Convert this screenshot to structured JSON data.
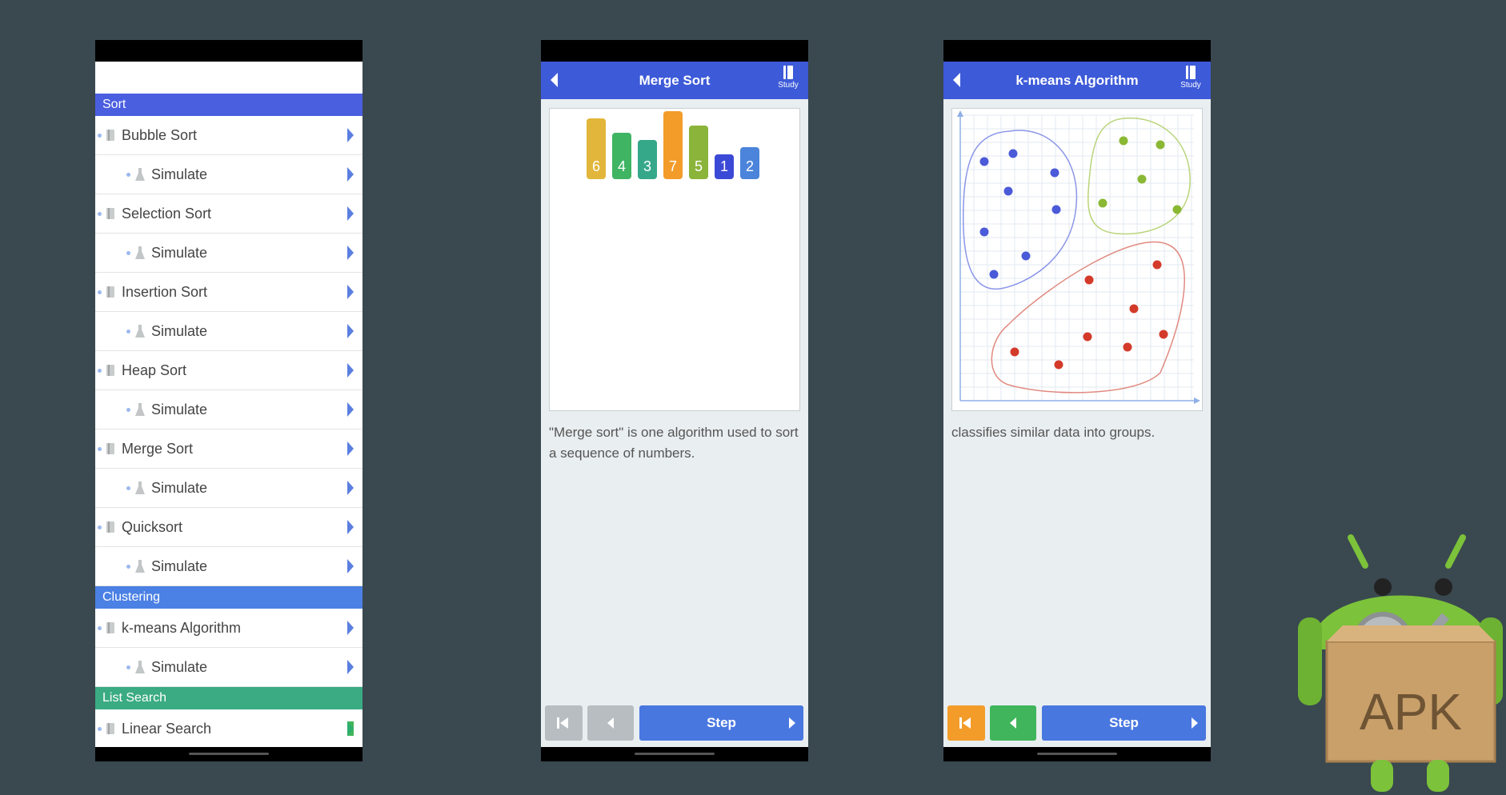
{
  "list_screen": {
    "sections": [
      {
        "label": "Sort",
        "color": "#4a5ee0",
        "items": [
          {
            "label": "Bubble Sort",
            "sub": "Simulate"
          },
          {
            "label": "Selection Sort",
            "sub": "Simulate"
          },
          {
            "label": "Insertion Sort",
            "sub": "Simulate"
          },
          {
            "label": "Heap Sort",
            "sub": "Simulate"
          },
          {
            "label": "Merge Sort",
            "sub": "Simulate"
          },
          {
            "label": "Quicksort",
            "sub": "Simulate"
          }
        ]
      },
      {
        "label": "Clustering",
        "color": "#4b80e4",
        "items": [
          {
            "label": "k-means Algorithm",
            "sub": "Simulate"
          }
        ]
      },
      {
        "label": "List Search",
        "color": "#3aab83",
        "items": [
          {
            "label": "Linear Search"
          }
        ]
      }
    ]
  },
  "merge_screen": {
    "title": "Merge Sort",
    "study_label": "Study",
    "bars": [
      {
        "value": "6",
        "color": "#e2b63a"
      },
      {
        "value": "4",
        "color": "#3fb463"
      },
      {
        "value": "3",
        "color": "#35a88a"
      },
      {
        "value": "7",
        "color": "#f39c2a"
      },
      {
        "value": "5",
        "color": "#8bb43a"
      },
      {
        "value": "1",
        "color": "#3b4ad6"
      },
      {
        "value": "2",
        "color": "#4b84da"
      }
    ],
    "description": "\"Merge sort\" is one algorithm used to sort a sequence of numbers.",
    "step_label": "Step"
  },
  "kmeans_screen": {
    "title": "k-means Algorithm",
    "study_label": "Study",
    "description": "classifies similar data into groups.",
    "step_label": "Step",
    "cluster_colors": {
      "blue": "#4a5ad8",
      "green": "#8ab834",
      "red": "#d33a2a"
    }
  },
  "apk_badge": {
    "text": "APK"
  }
}
